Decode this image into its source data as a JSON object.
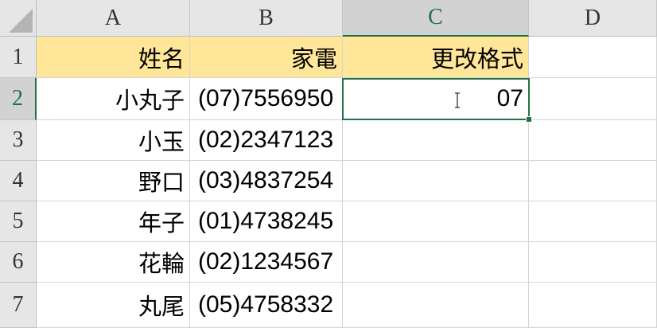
{
  "columns": [
    "A",
    "B",
    "C",
    "D"
  ],
  "rows": [
    "1",
    "2",
    "3",
    "4",
    "5",
    "6",
    "7"
  ],
  "selected_cell": "C2",
  "headers": {
    "a": "姓名",
    "b": "家電",
    "c": "更改格式"
  },
  "data": [
    {
      "name": "小丸子",
      "phone": "(07)7556950",
      "c": "07"
    },
    {
      "name": "小玉",
      "phone": "(02)2347123",
      "c": ""
    },
    {
      "name": "野口",
      "phone": "(03)4837254",
      "c": ""
    },
    {
      "name": "年子",
      "phone": "(01)4738245",
      "c": ""
    },
    {
      "name": "花輪",
      "phone": "(02)1234567",
      "c": ""
    },
    {
      "name": "丸尾",
      "phone": "(05)4758332",
      "c": ""
    }
  ],
  "colors": {
    "header_fill": "#ffe699",
    "selection": "#217346"
  }
}
